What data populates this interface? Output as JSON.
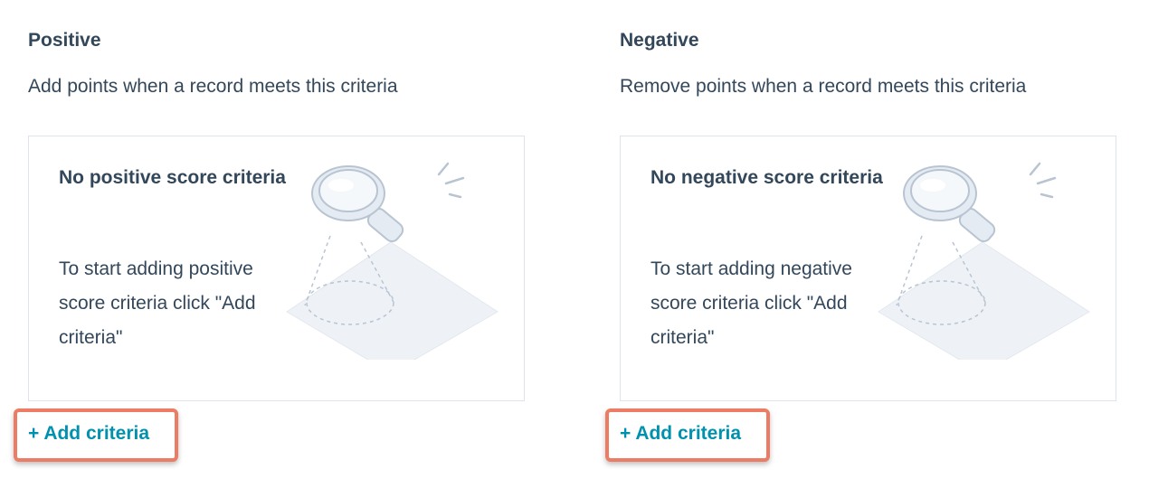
{
  "positive": {
    "title": "Positive",
    "description": "Add points when a record meets this criteria",
    "empty_title": "No positive score criteria",
    "empty_body": "To start adding positive score criteria click \"Add criteria\"",
    "add_label": "+ Add criteria",
    "illustration_icon": "magnifying-glass-icon"
  },
  "negative": {
    "title": "Negative",
    "description": "Remove points when a record meets this criteria",
    "empty_title": "No negative score criteria",
    "empty_body": "To start adding negative score criteria click \"Add criteria\"",
    "add_label": "+ Add criteria",
    "illustration_icon": "magnifying-glass-icon"
  },
  "colors": {
    "text": "#33475b",
    "link": "#0091ae",
    "card_border": "#dfe3eb",
    "highlight": "#ec7c63"
  }
}
